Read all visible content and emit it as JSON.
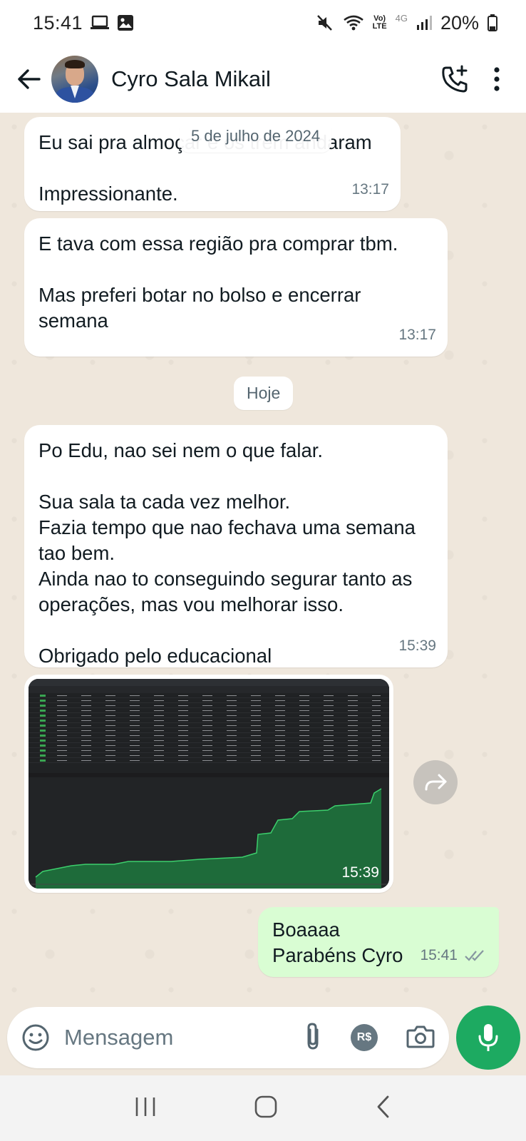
{
  "status_bar": {
    "time": "15:41",
    "net_label_top": "Vo)",
    "net_label_bottom": "LTE",
    "net_4g": "4G",
    "battery": "20%"
  },
  "header": {
    "contact_name": "Cyro Sala Mikail"
  },
  "chat": {
    "floating_date": "5 de julho de 2024",
    "today_label": "Hoje",
    "messages": [
      {
        "text": "Eu sai pra almoçar e os trem andaram\n\nImpressionante.",
        "time": "13:17"
      },
      {
        "text": "E tava com essa região pra comprar tbm.\n\nMas preferi botar no bolso e encerrar semana",
        "time": "13:17"
      },
      {
        "text": "Po Edu, nao sei nem o que falar.\n\nSua sala ta cada vez melhor.\nFazia tempo que nao fechava uma semana tao bem.\nAinda nao to conseguindo segurar tanto as operações, mas vou melhorar isso.\n\nObrigado pelo educacional",
        "time": "15:39"
      }
    ],
    "image_message": {
      "time": "15:39"
    },
    "outgoing": {
      "text": "Boaaaa\nParabéns Cyro",
      "time": "15:41"
    }
  },
  "input": {
    "placeholder": "Mensagem",
    "pix_label": "R$"
  },
  "colors": {
    "outgoing_bubble": "#d9fdd3",
    "mic_button": "#1daa61",
    "chat_background": "#efe7dc"
  }
}
